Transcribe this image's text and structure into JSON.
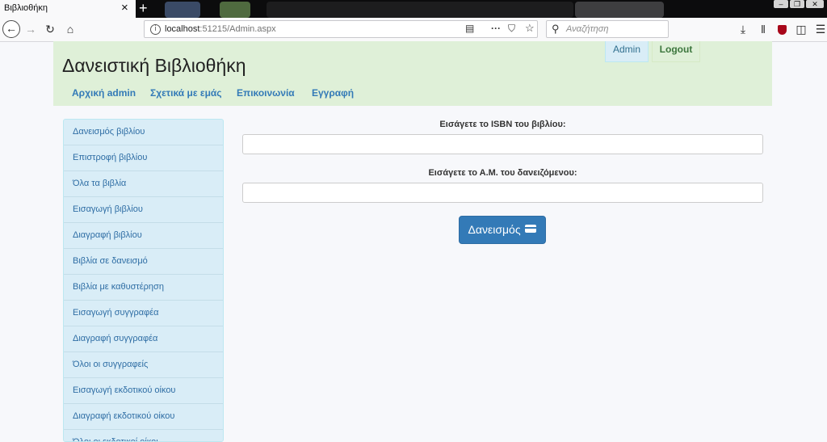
{
  "browser": {
    "tab_title": "Βιβλιοθήκη",
    "tab_close": "×",
    "new_tab": "+",
    "url_host": "localhost",
    "url_rest": ":51215/Admin.aspx",
    "search_placeholder": "Αναζήτηση",
    "icons": [
      "back-arrow-icon",
      "forward-arrow-icon",
      "reload-icon",
      "home-icon",
      "info-icon",
      "reader-view-icon",
      "more-actions-icon",
      "pocket-icon",
      "bookmark-star-icon",
      "search-icon",
      "downloads-icon",
      "library-icon",
      "ublock-icon",
      "sidebar-icon",
      "menu-icon"
    ]
  },
  "header": {
    "title": "Δανειστική Βιβλιοθήκη",
    "nav": [
      "Αρχική admin",
      "Σχετικά με εμάς",
      "Επικοινωνία",
      "Εγγραφή"
    ],
    "admin_label": "Admin",
    "logout_label": "Logout"
  },
  "sidebar": {
    "items": [
      "Δανεισμός βιβλίου",
      "Επιστροφή βιβλίου",
      "Όλα τα βιβλία",
      "Εισαγωγή βιβλίου",
      "Διαγραφή βιβλίου",
      "Βιβλία σε δανεισμό",
      "Βιβλία με καθυστέρηση",
      "Εισαγωγή συγγραφέα",
      "Διαγραφή συγγραφέα",
      "Όλοι οι συγγραφείς",
      "Εισαγωγή εκδοτικού οίκου",
      "Διαγραφή εκδοτικού οίκου",
      "Όλοι οι εκδοτικοί οίκοι"
    ]
  },
  "form": {
    "isbn_label": "Εισάγετε το ISBN του βιβλίου:",
    "isbn_value": "",
    "am_label": "Εισάγετε το Α.Μ. του δανειζόμενου:",
    "am_value": "",
    "submit_label": "Δανεισμός",
    "submit_icon": "credit-card-icon"
  },
  "colors": {
    "header_bg": "#dff0d8",
    "sidebar_bg": "#d9edf7",
    "link": "#337ab7",
    "primary_button": "#337ab7"
  }
}
